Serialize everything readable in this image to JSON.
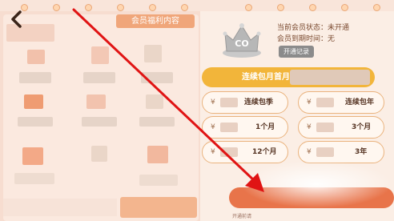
{
  "panel": {
    "tab_label": "会员福利内容"
  },
  "status": {
    "member_status_label": "当前会员状态：",
    "member_status_value": "未开通",
    "expiry_label": "会员到期时间：",
    "expiry_value": "无",
    "history_button": "开通记录",
    "badge_text": "CO"
  },
  "plans": {
    "first_month": "连续包月首月",
    "continuous_season": "连续包季",
    "continuous_year": "连续包年",
    "one_month": "1个月",
    "three_months": "3个月",
    "twelve_months": "12个月",
    "three_years": "3年",
    "currency": "¥"
  },
  "pay": {
    "note": "开通前请"
  },
  "colors": {
    "accent_gold": "#f2b53a",
    "accent_orange": "#e8744a",
    "arrow_red": "#e01414"
  }
}
